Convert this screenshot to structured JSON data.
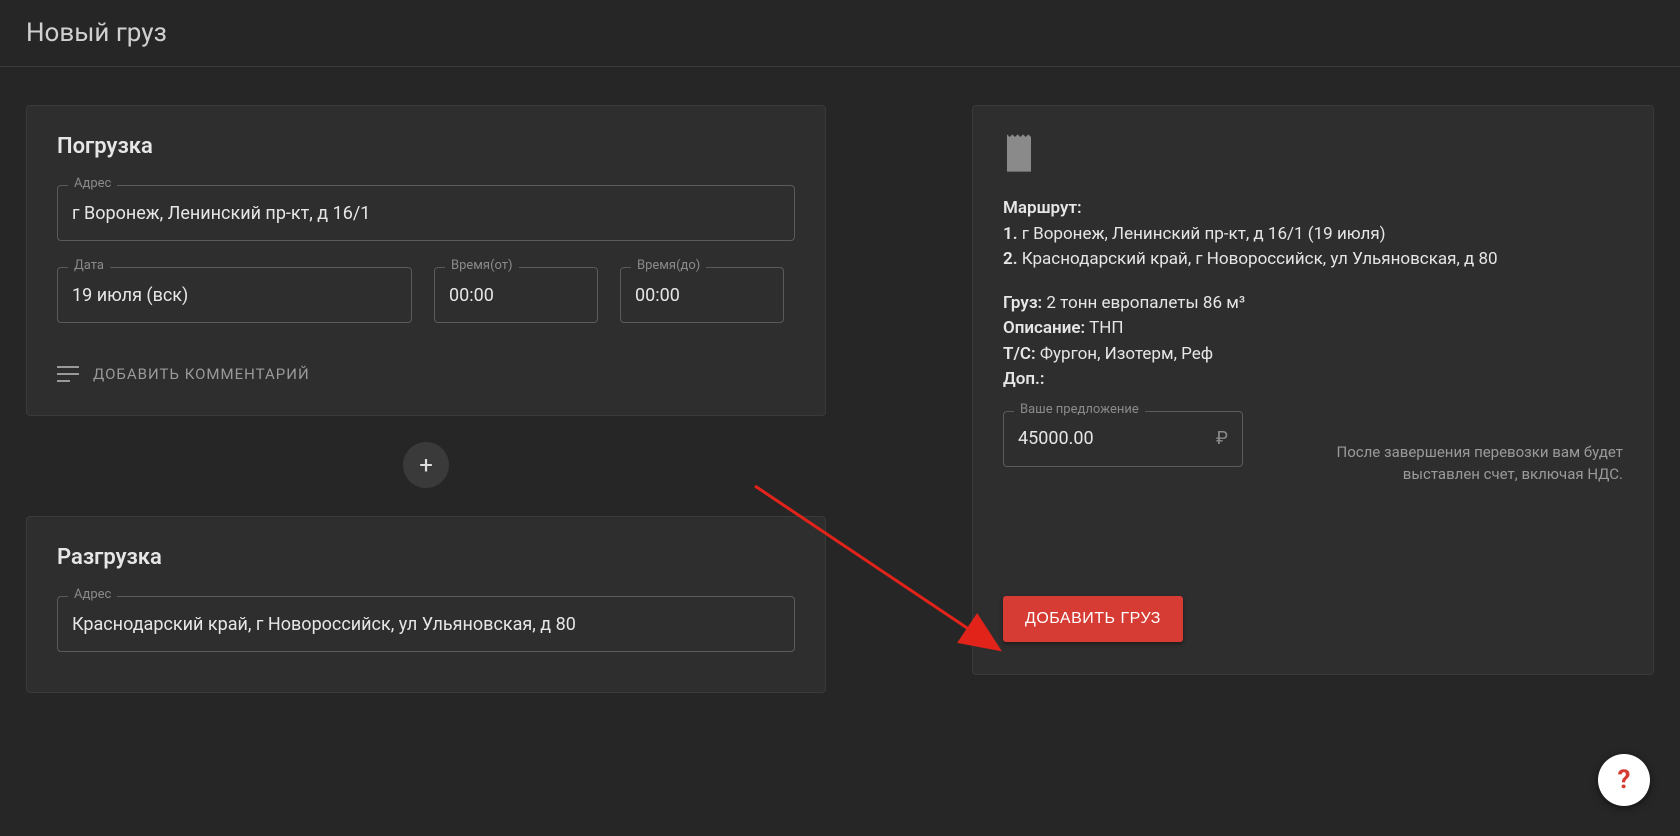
{
  "page": {
    "title": "Новый груз"
  },
  "loading": {
    "title": "Погрузка",
    "address_label": "Адрес",
    "address": "г Воронеж, Ленинский пр-кт, д 16/1",
    "date_label": "Дата",
    "date": "19 июля (вск)",
    "time_from_label": "Время(от)",
    "time_from": "00:00",
    "time_to_label": "Время(до)",
    "time_to": "00:00",
    "add_comment": "ДОБАВИТЬ КОММЕНТАРИЙ"
  },
  "unloading": {
    "title": "Разгрузка",
    "address_label": "Адрес",
    "address": "Краснодарский край, г Новороссийск, ул Ульяновская, д 80"
  },
  "summary": {
    "route_label": "Маршрут:",
    "route1_no": "1.",
    "route1": "г Воронеж, Ленинский пр-кт, д 16/1 (19 июля)",
    "route2_no": "2.",
    "route2": "Краснодарский край, г Новороссийск, ул Ульяновская, д 80",
    "cargo_label": "Груз:",
    "cargo": "2 тонн европалеты 86 м³",
    "desc_label": "Описание:",
    "desc": "ТНП",
    "ts_label": "Т/С:",
    "ts": "Фургон, Изотерм, Реф",
    "extra_label": "Доп.:",
    "extra": "",
    "offer_label": "Ваше предложение",
    "offer": "45000.00",
    "currency": "₽",
    "offer_note": "После завершения перевозки вам будет выставлен счет, включая НДС.",
    "submit": "ДОБАВИТЬ ГРУЗ"
  }
}
